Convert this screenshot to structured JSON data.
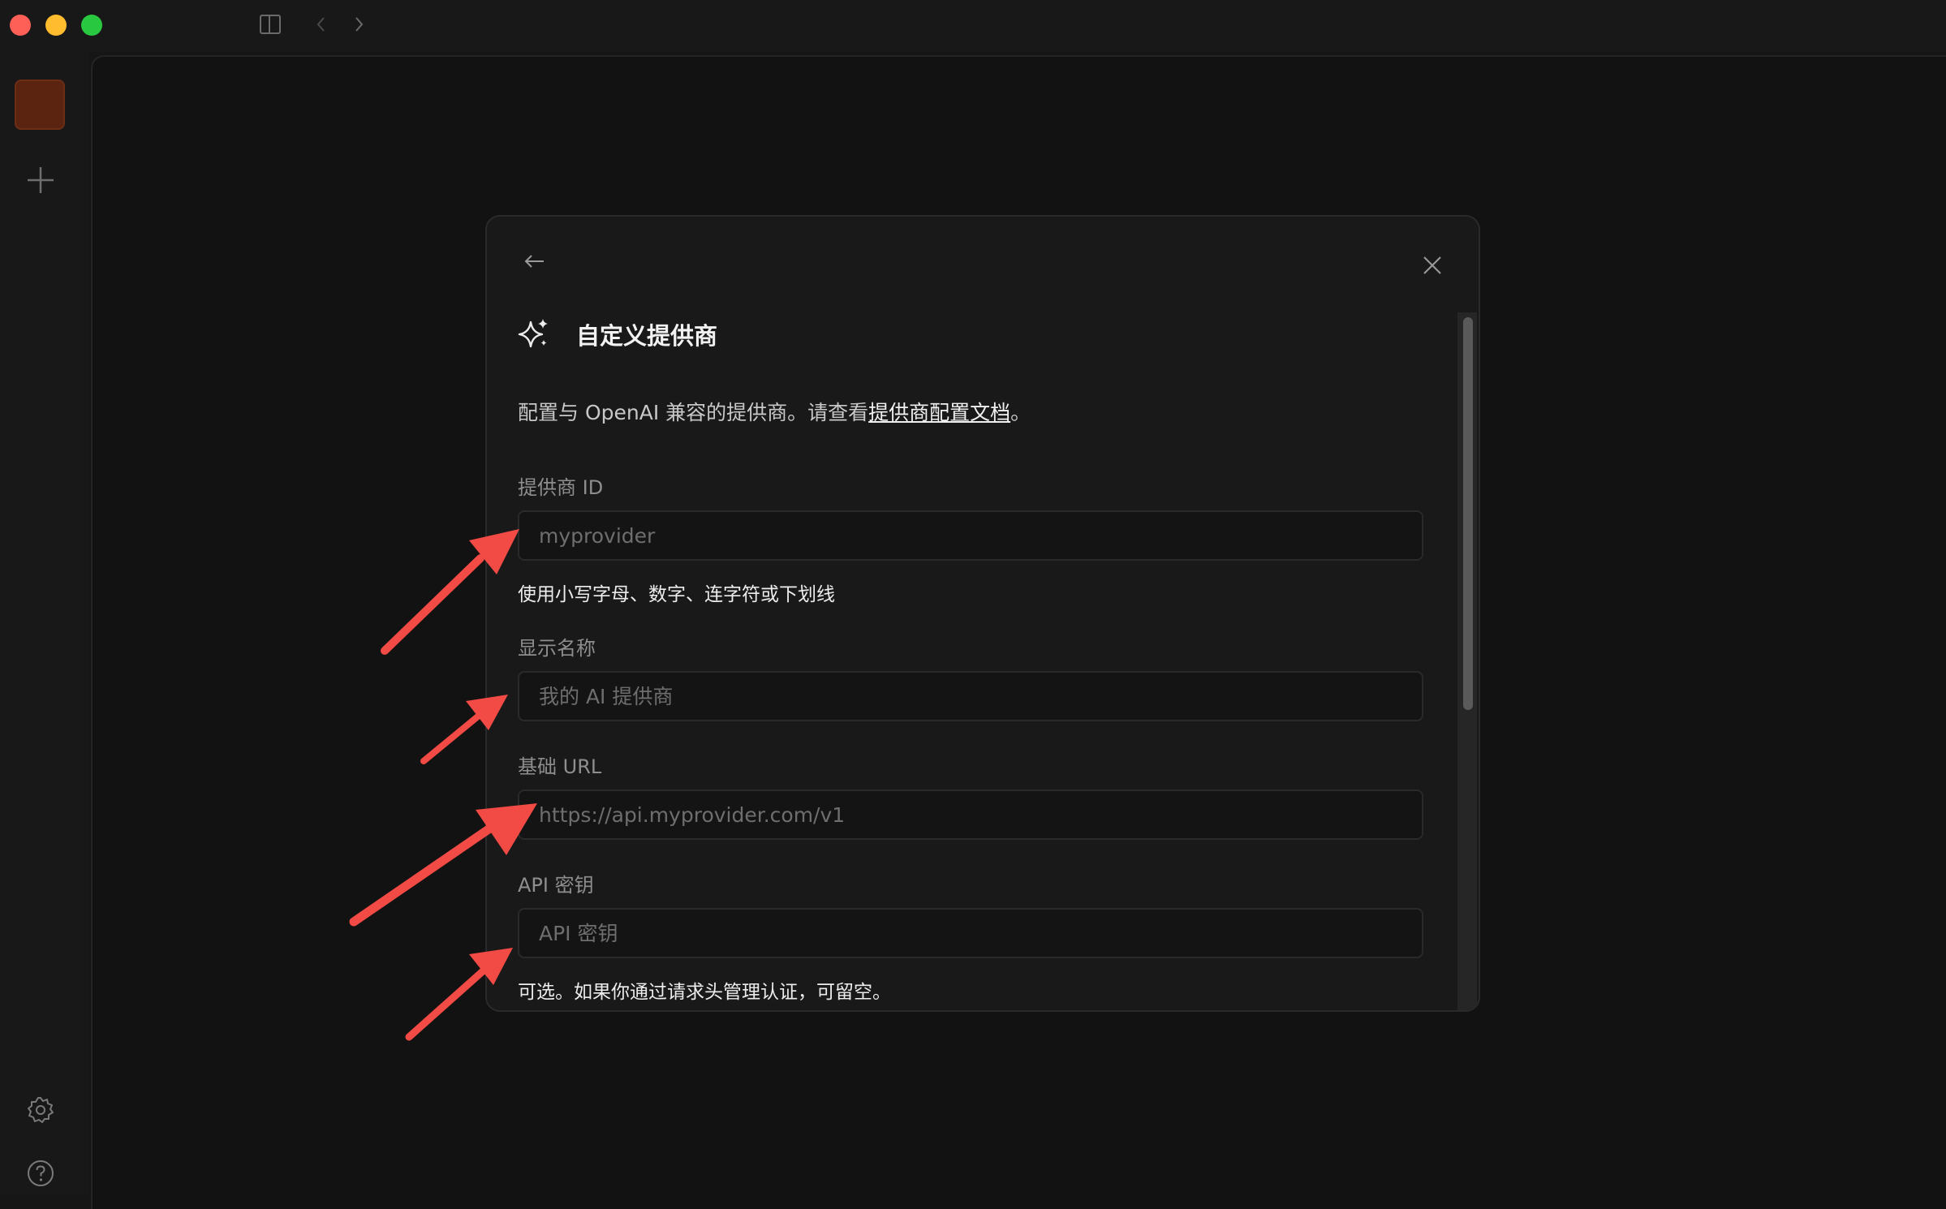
{
  "window": {
    "controls": [
      "close",
      "minimize",
      "maximize"
    ],
    "toolbar_icons": [
      "sidebar-toggle-icon",
      "back-arrow-icon",
      "forward-arrow-icon"
    ]
  },
  "sidebar": {
    "items": [
      {
        "name": "workspace-avatar",
        "color": "#5b2410"
      },
      {
        "icon": "plus-icon"
      },
      {
        "icon": "gear-icon"
      },
      {
        "icon": "help-icon"
      }
    ]
  },
  "dialog": {
    "title": "自定义提供商",
    "title_icon": "sparkles-icon",
    "description_prefix": "配置与 OpenAI 兼容的提供商。请查看",
    "description_link": "提供商配置文档",
    "description_suffix": "。",
    "fields": {
      "provider_id": {
        "label": "提供商 ID",
        "placeholder": "myprovider",
        "hint": "使用小写字母、数字、连字符或下划线"
      },
      "display_name": {
        "label": "显示名称",
        "placeholder": "我的 AI 提供商"
      },
      "base_url": {
        "label": "基础 URL",
        "placeholder": "https://api.myprovider.com/v1"
      },
      "api_key": {
        "label": "API 密钥",
        "placeholder": "API 密钥",
        "hint": "可选。如果你通过请求头管理认证，可留空。"
      }
    }
  },
  "colors": {
    "background": "#121212",
    "dialog": "#191919",
    "annotation_arrow": "#f24a44"
  }
}
